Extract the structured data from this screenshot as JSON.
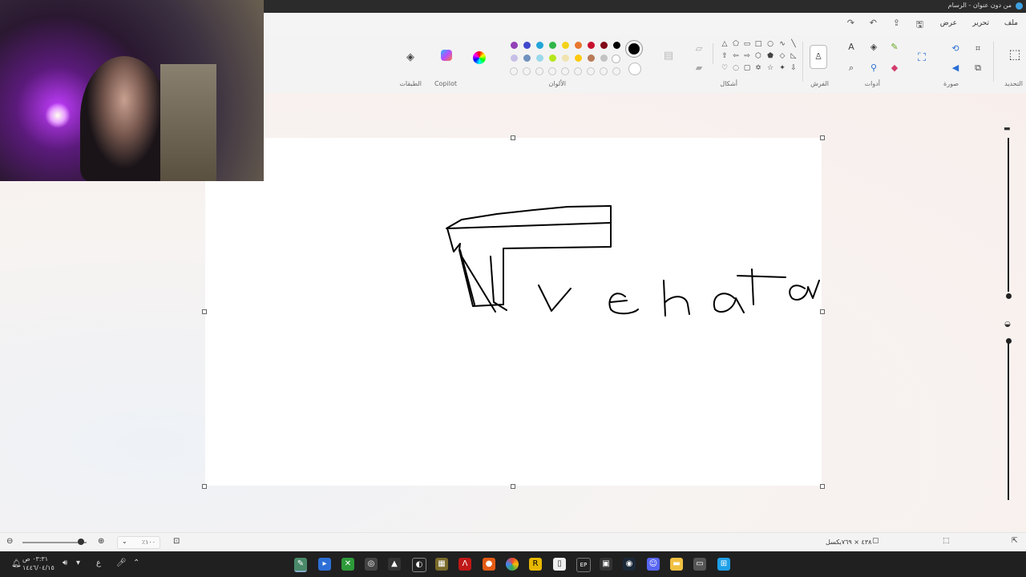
{
  "window": {
    "title": "من دون عنوان - الرسام"
  },
  "menu": {
    "file": "ملف",
    "edit": "تحرير",
    "view": "عرض"
  },
  "quick_access": [
    "save-icon",
    "share-icon",
    "undo-icon",
    "redo-icon"
  ],
  "ribbon": {
    "groups": {
      "selection": "التحديد",
      "image": "صورة",
      "tools": "أدوات",
      "brushes": "الفرش",
      "shapes": "أشكال",
      "colors": "الألوان",
      "copilot": "Copilot",
      "layers": "الطبقات"
    },
    "color_swatches": [
      [
        "#000000",
        "#7f0a16",
        "#c8102e",
        "#e8762d",
        "#f3d21c",
        "#31b64a",
        "#22a5d8",
        "#3f48cc",
        "#9241b8"
      ],
      [
        "#ffffff",
        "#c3c3c3",
        "#b97a57",
        "#ffc90e",
        "#efe4b0",
        "#b5e61d",
        "#99d9ea",
        "#7092be",
        "#c8bfe7"
      ],
      [
        "",
        "",
        "",
        "",
        "",
        "",
        "",
        "",
        ""
      ]
    ],
    "primary_color": "#000000",
    "secondary_color": "#ffffff"
  },
  "canvas": {
    "drawing_strokes": "hand-drawn rectangle shapes and the letters v e h a t a v"
  },
  "statusbar": {
    "dimensions": "٤٣٨ × ٧٦٩بكسل",
    "zoom_label": "٪١٠٠"
  },
  "taskbar": {
    "time": "٠٣:٣١ ص",
    "date": "١٤٤٦/٠٤/١٥",
    "lang": "ع"
  }
}
